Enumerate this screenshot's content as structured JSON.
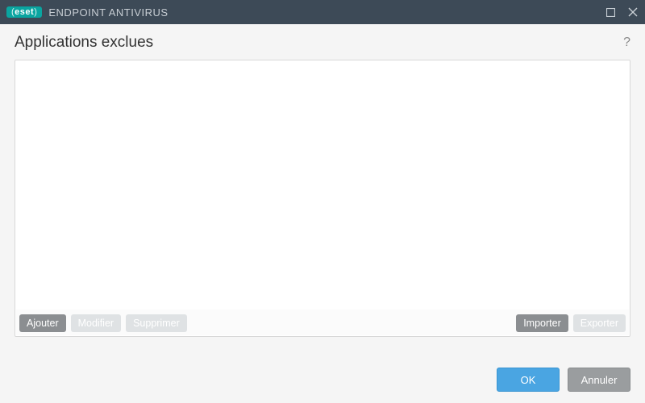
{
  "titlebar": {
    "brand_badge": "eset",
    "product_name": "ENDPOINT ANTIVIRUS"
  },
  "page": {
    "title": "Applications exclues"
  },
  "toolbar": {
    "add": "Ajouter",
    "edit": "Modifier",
    "delete": "Supprimer",
    "import": "Importer",
    "export": "Exporter"
  },
  "footer": {
    "ok": "OK",
    "cancel": "Annuler"
  }
}
